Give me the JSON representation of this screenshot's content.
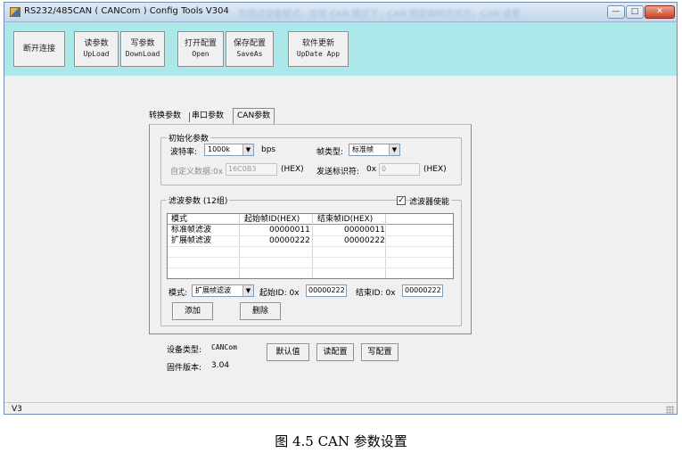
{
  "window": {
    "title": "RS232/485CAN ( CANCom ) Config Tools V304",
    "title_blurred": "为调试设备模式，在非 CAN 模式下，CAN 固定编码方式为，CAN 设置",
    "min_glyph": "—",
    "max_glyph": "□",
    "close_glyph": "✕"
  },
  "toolbar": {
    "disconnect": "断开连接",
    "read": {
      "cn": "读参数",
      "en": "UpLoad"
    },
    "write": {
      "cn": "写参数",
      "en": "DownLoad"
    },
    "open": {
      "cn": "打开配置",
      "en": "Open"
    },
    "save": {
      "cn": "保存配置",
      "en": "SaveAs"
    },
    "update": {
      "cn": "软件更新",
      "en": "UpDate App"
    }
  },
  "tabs": [
    "转换参数",
    "串口参数",
    "CAN参数"
  ],
  "init_group": {
    "title": "初始化参数",
    "baud_label": "波特率:",
    "baud_value": "1000k",
    "baud_unit": "bps",
    "frame_type_label": "帧类型:",
    "frame_type_value": "标准帧",
    "custom_label": "自定义数据:0x",
    "custom_value": "16C0B3",
    "custom_hex": "(HEX)",
    "send_id_label": "发送标识符:",
    "send_id_prefix": "0x",
    "send_id_value": "0",
    "send_id_hex": "(HEX)"
  },
  "filter_group": {
    "title": "滤波参数 (12组)",
    "enable_label": "滤波器使能",
    "enable_checked": true,
    "check_glyph": "✓",
    "columns": [
      "模式",
      "起始帧ID(HEX)",
      "结束帧ID(HEX)"
    ],
    "rows": [
      [
        "标准帧滤波",
        "00000011",
        "00000011"
      ],
      [
        "扩展帧滤波",
        "00000222",
        "00000222"
      ]
    ],
    "mode_label": "模式:",
    "mode_value": "扩展帧滤波",
    "start_label": "起始ID: 0x",
    "start_value": "00000222",
    "end_label": "结束ID: 0x",
    "end_value": "00000222",
    "add_button": "添加",
    "delete_button": "删除"
  },
  "device": {
    "type_label": "设备类型:",
    "type_value": "CANCom",
    "fw_label": "固件版本:",
    "fw_value": "3.04",
    "default_button": "默认值",
    "read_button": "读配置",
    "write_button": "写配置"
  },
  "status": {
    "text": "V3"
  },
  "caption": "图 4.5 CAN 参数设置",
  "colors": {
    "toolbar_bg": "#ace8ea",
    "window_bg": "#f0f0f0"
  }
}
